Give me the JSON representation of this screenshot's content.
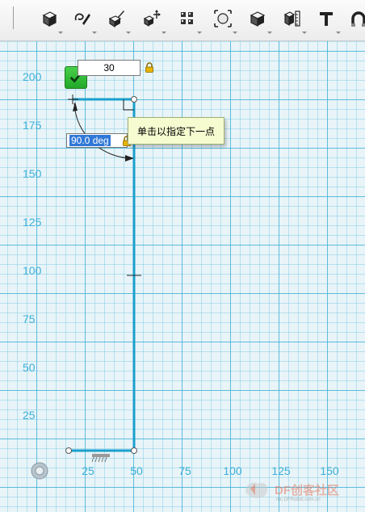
{
  "toolbar": {
    "tools": [
      {
        "name": "primitives-tool",
        "icon": "box-primitives-icon"
      },
      {
        "name": "sketch-tool",
        "icon": "sketch-pencil-icon"
      },
      {
        "name": "construct-tool",
        "icon": "construct-brush-icon"
      },
      {
        "name": "modify-tool",
        "icon": "move-modify-icon"
      },
      {
        "name": "pattern-tool",
        "icon": "pattern-grid-icon"
      },
      {
        "name": "group-tool",
        "icon": "group-select-icon"
      },
      {
        "name": "combine-tool",
        "icon": "combine-solid-icon"
      },
      {
        "name": "measure-tool",
        "icon": "measure-ruler-icon"
      },
      {
        "name": "text-tool",
        "icon": "text-T-icon"
      },
      {
        "name": "snap-tool",
        "icon": "magnet-snap-icon"
      }
    ]
  },
  "grid": {
    "y_labels": [
      "200",
      "175",
      "150",
      "125",
      "100",
      "75",
      "50",
      "25"
    ],
    "x_labels": [
      "25",
      "50",
      "75",
      "100",
      "125",
      "150"
    ]
  },
  "sketch": {
    "length_value": "30",
    "angle_value": "90.0 deg",
    "tooltip": "单击以指定下一点"
  },
  "watermark": {
    "text": "DF创客社区",
    "sub": "mc.DFRobot.com.cn"
  },
  "colors": {
    "grid_major": "#40b0d6",
    "axis_label": "#3ab0d8",
    "sketch_line": "#1a9fcc",
    "tooltip_bg": "#f6fbd0",
    "confirm_green": "#2eb834"
  }
}
